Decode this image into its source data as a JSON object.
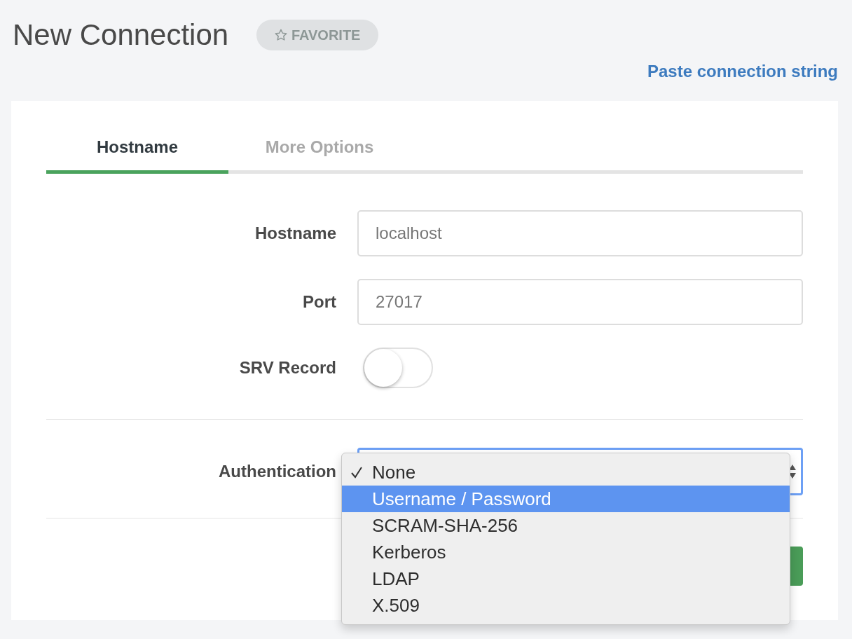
{
  "title": "New Connection",
  "favorite_button": {
    "label": "FAVORITE"
  },
  "paste_link": "Paste connection string",
  "tabs": [
    {
      "label": "Hostname",
      "selected": true
    },
    {
      "label": "More Options",
      "selected": false
    }
  ],
  "fields": [
    {
      "kind": "text",
      "label": "Hostname",
      "placeholder": "localhost"
    },
    {
      "kind": "text",
      "label": "Port",
      "placeholder": "27017"
    },
    {
      "kind": "toggle",
      "label": "SRV Record",
      "on": false
    }
  ],
  "authentication": {
    "label": "Authentication",
    "dropdown_open": true,
    "options": [
      {
        "label": "None",
        "selected": true,
        "highlighted": false
      },
      {
        "label": "Username / Password",
        "selected": false,
        "highlighted": true
      },
      {
        "label": "SCRAM-SHA-256",
        "selected": false,
        "highlighted": false
      },
      {
        "label": "Kerberos",
        "selected": false,
        "highlighted": false
      },
      {
        "label": "LDAP",
        "selected": false,
        "highlighted": false
      },
      {
        "label": "X.509",
        "selected": false,
        "highlighted": false
      }
    ]
  }
}
